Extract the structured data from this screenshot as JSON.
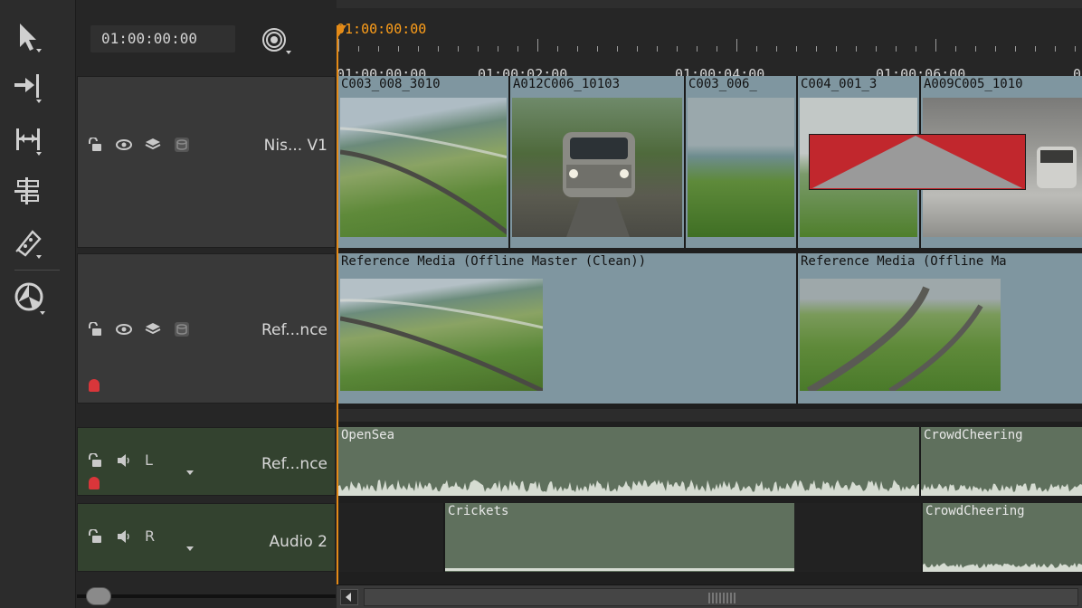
{
  "toolbar": {
    "tools": [
      {
        "name": "select-tool",
        "icon": "arrow-cursor-icon"
      },
      {
        "name": "track-select-tool",
        "icon": "arrow-bar-icon"
      },
      {
        "name": "slip-tool",
        "icon": "bracket-arrows-icon"
      },
      {
        "name": "multi-tool",
        "icon": "align-icon"
      },
      {
        "name": "razor-tool",
        "icon": "razor-icon"
      },
      {
        "name": "retime-tool",
        "icon": "wheel-icon"
      }
    ]
  },
  "header": {
    "timecode": "01:00:00:00",
    "playhead_timecode": "01:00:00:00"
  },
  "ruler": {
    "labels": [
      "01:00:00:00",
      "01:00:02:00",
      "01:00:04:00",
      "01:00:06:00",
      "0"
    ]
  },
  "tracks": [
    {
      "id": "v1",
      "kind": "video",
      "name": "Nis... V1"
    },
    {
      "id": "ref",
      "kind": "video",
      "name": "Ref...nce"
    },
    {
      "id": "a1",
      "kind": "audio",
      "channel": "L",
      "name": "Ref...nce"
    },
    {
      "id": "a2",
      "kind": "audio",
      "channel": "R",
      "name": "Audio 2"
    }
  ],
  "clips": {
    "v1": [
      "C003_008_3010",
      "A012C006_10103",
      "C003_006_",
      "C004_001_3",
      "A009C005_1010"
    ],
    "ref": [
      "Reference Media (Offline Master (Clean))",
      "Reference Media (Offline Ma"
    ],
    "a1": [
      "OpenSea",
      "CrowdCheering"
    ],
    "a2": [
      "Crickets",
      "CrowdCheering"
    ]
  },
  "colors": {
    "playhead": "#ff9f1a",
    "video_clip": "#7f96a0",
    "audio_clip": "#5f705d",
    "audio_header": "#33422f",
    "offline_red": "#c1272d"
  }
}
